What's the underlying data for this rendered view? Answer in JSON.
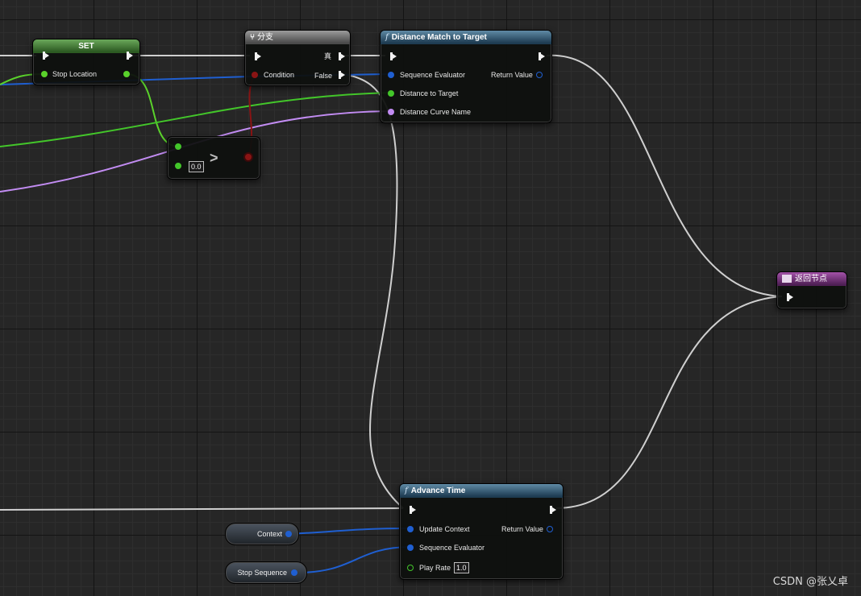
{
  "colors": {
    "exec_wire": "#cfcfcf",
    "vector_pin": "#5ad22b",
    "struct_pin": "#1f5fd1",
    "name_pin": "#c28cf2",
    "bool_pin": "#8a1414",
    "float_pin": "#43c62a"
  },
  "set_node": {
    "title": "SET",
    "pin_stop_location": "Stop Location"
  },
  "branch_node": {
    "title": "分支",
    "icon": "branch-icon",
    "pin_condition": "Condition",
    "pin_true": "真",
    "pin_false": "False"
  },
  "compare_node": {
    "operator": ">",
    "value": "0.0"
  },
  "distance_match_node": {
    "title": "Distance Match to Target",
    "icon": "function-icon",
    "pin_sequence_evaluator": "Sequence Evaluator",
    "pin_distance_to_target": "Distance to Target",
    "pin_distance_curve_name": "Distance Curve Name",
    "pin_return_value": "Return Value"
  },
  "return_node": {
    "title": "返回节点",
    "icon": "return-icon"
  },
  "advance_time_node": {
    "title": "Advance Time",
    "icon": "function-icon",
    "pin_update_context": "Update Context",
    "pin_sequence_evaluator": "Sequence Evaluator",
    "pin_play_rate": "Play Rate",
    "play_rate_value": "1.0",
    "pin_return_value": "Return Value"
  },
  "variables": {
    "context": "Context",
    "stop_sequence": "Stop Sequence"
  },
  "watermark": "CSDN @张乂卓"
}
